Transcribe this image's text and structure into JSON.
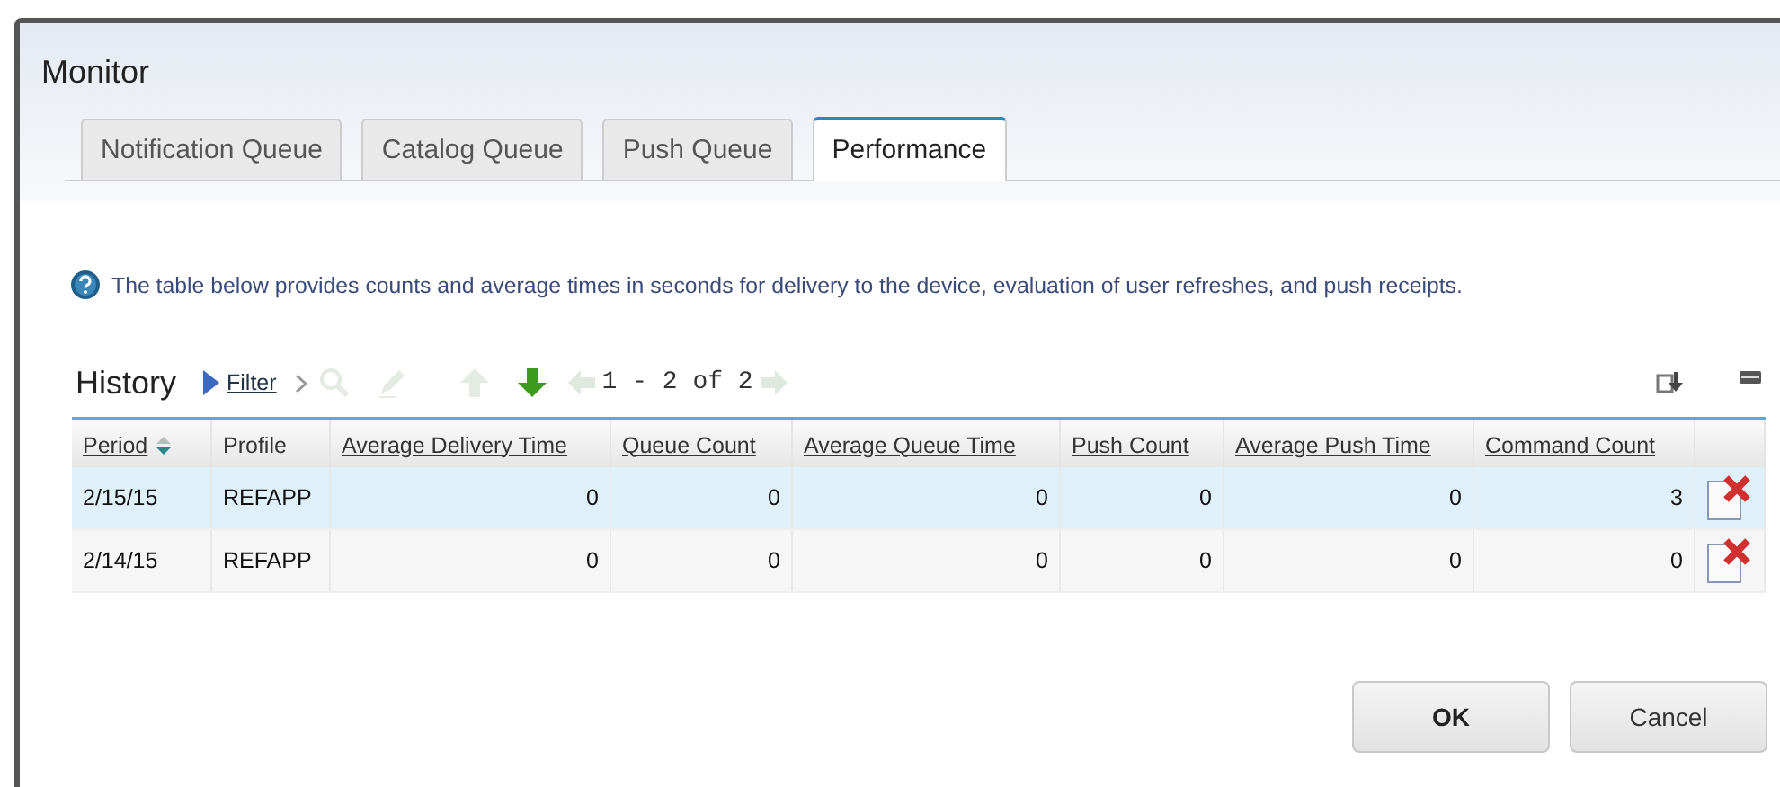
{
  "window": {
    "title": "Monitor"
  },
  "tabs": [
    {
      "label": "Notification Queue",
      "selected": false
    },
    {
      "label": "Catalog Queue",
      "selected": false
    },
    {
      "label": "Push Queue",
      "selected": false
    },
    {
      "label": "Performance",
      "selected": true
    }
  ],
  "info": {
    "text": "The table below provides counts and average times in seconds for delivery to the device, evaluation of user refreshes, and push receipts."
  },
  "history": {
    "title": "History",
    "filter": "Filter",
    "tools": [
      {
        "kind": "search",
        "disabled": true
      },
      {
        "kind": "edit",
        "disabled": true
      },
      {
        "kind": "up",
        "disabled": true
      },
      {
        "kind": "down",
        "disabled": false
      }
    ],
    "pager": "1 - 2 of 2",
    "prev_disabled": true,
    "next_disabled": true
  },
  "table": {
    "columns": [
      {
        "label": "Period",
        "sortable": true,
        "sorted": true
      },
      {
        "label": "Profile",
        "sortable": false,
        "sorted": false
      },
      {
        "label": "Average Delivery Time",
        "sortable": true,
        "sorted": false
      },
      {
        "label": "Queue Count",
        "sortable": true,
        "sorted": false
      },
      {
        "label": "Average Queue Time",
        "sortable": true,
        "sorted": false
      },
      {
        "label": "Push Count",
        "sortable": true,
        "sorted": false
      },
      {
        "label": "Average Push Time",
        "sortable": true,
        "sorted": false
      },
      {
        "label": "Command Count",
        "sortable": true,
        "sorted": false
      }
    ],
    "rows": [
      {
        "selected": true,
        "cells": [
          "2/15/15",
          "REFAPP",
          "0",
          "0",
          "0",
          "0",
          "0",
          "3"
        ]
      },
      {
        "selected": false,
        "cells": [
          "2/14/15",
          "REFAPP",
          "0",
          "0",
          "0",
          "0",
          "0",
          "0"
        ]
      }
    ]
  },
  "buttons": [
    {
      "label": "OK",
      "kind": "primary"
    },
    {
      "label": "Cancel",
      "kind": "secondary"
    }
  ]
}
